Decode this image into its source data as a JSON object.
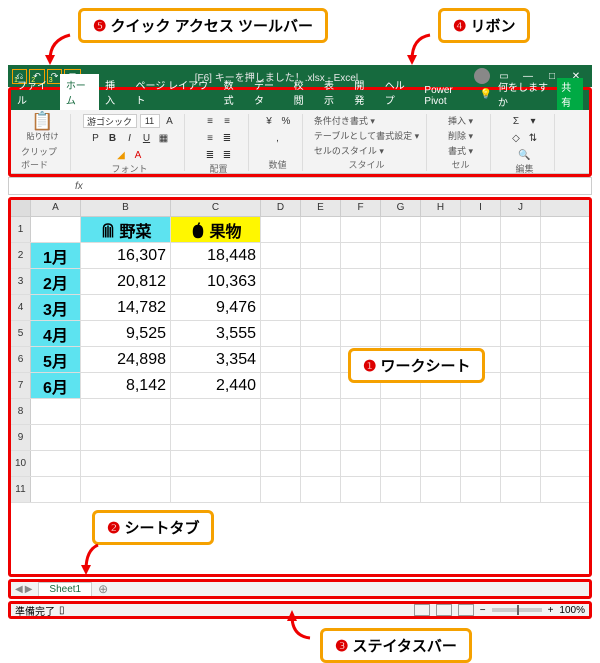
{
  "callouts": {
    "c1_num": "❶",
    "c1_label": "ワークシート",
    "c2_num": "❷",
    "c2_label": "シートタブ",
    "c3_num": "❸",
    "c3_label": "ステイタスバー",
    "c4_num": "❹",
    "c4_label": "リボン",
    "c5_num": "❺",
    "c5_label": "クイック アクセス ツールバー"
  },
  "titlebar": {
    "title": "[F6] キーを押しました！.xlsx - Excel",
    "qat_items": [
      "⎌",
      "↶",
      "↷",
      "▢"
    ],
    "qat_nums": [
      "1",
      "2",
      "3",
      "4"
    ]
  },
  "ribbon": {
    "tabs": [
      "ファイル",
      "ホーム",
      "挿入",
      "ページ レイアウト",
      "数式",
      "データ",
      "校閲",
      "表示",
      "開発",
      "ヘルプ",
      "Power Pivot"
    ],
    "active_index": 1,
    "tell_me": "何をしますか",
    "share": "共有",
    "groups": {
      "clipboard": {
        "label": "クリップボード",
        "paste": "貼り付け"
      },
      "font": {
        "label": "フォント",
        "font_name": "游ゴシック",
        "font_size": "11",
        "font_style_a": "A",
        "font_style_p": "P"
      },
      "align": {
        "label": "配置"
      },
      "number": {
        "label": "数値"
      },
      "style": {
        "label": "スタイル",
        "items": [
          "条件付き書式 ▾",
          "テーブルとして書式設定 ▾",
          "セルのスタイル ▾"
        ]
      },
      "cell": {
        "label": "セル",
        "items": [
          "挿入 ▾",
          "削除 ▾",
          "書式 ▾"
        ]
      },
      "edit": {
        "label": "編集"
      }
    }
  },
  "formula_bar": {
    "namebox": "",
    "fx": "fx"
  },
  "sheet": {
    "col_letters": [
      "A",
      "B",
      "C",
      "D",
      "E",
      "F",
      "G",
      "H",
      "I",
      "J"
    ],
    "header": {
      "a": "",
      "b": "野菜",
      "c": "果物"
    },
    "rows": [
      {
        "month": "1月",
        "veg": "16,307",
        "fruit": "18,448"
      },
      {
        "month": "2月",
        "veg": "20,812",
        "fruit": "10,363"
      },
      {
        "month": "3月",
        "veg": "14,782",
        "fruit": "9,476"
      },
      {
        "month": "4月",
        "veg": "9,525",
        "fruit": "3,555"
      },
      {
        "month": "5月",
        "veg": "24,898",
        "fruit": "3,354"
      },
      {
        "month": "6月",
        "veg": "8,142",
        "fruit": "2,440"
      }
    ],
    "row_numbers": [
      "1",
      "2",
      "3",
      "4",
      "5",
      "6",
      "7",
      "8",
      "9",
      "10",
      "11"
    ]
  },
  "sheettabs": {
    "tab1": "Sheet1",
    "add": "⊕"
  },
  "statusbar": {
    "ready": "準備完了",
    "zoom": "100%",
    "plus": "+"
  }
}
